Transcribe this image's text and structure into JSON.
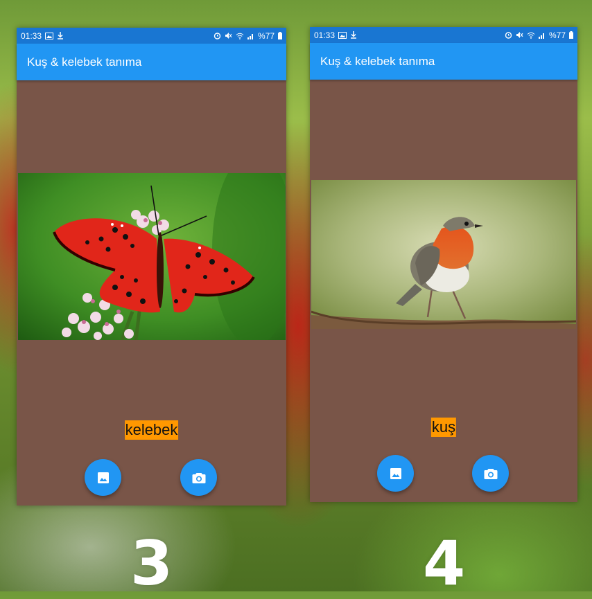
{
  "screens": [
    {
      "status": {
        "time": "01:33",
        "battery": "%77",
        "left_icons": [
          "image-icon",
          "download-icon"
        ],
        "right_icons": [
          "alarm-icon",
          "mute-icon",
          "wifi-icon",
          "signal-icon",
          "battery-icon"
        ]
      },
      "app_title": "Kuş & kelebek tanıma",
      "photo_subject": "red butterfly on pink flowers",
      "result_label": "kelebek",
      "buttons": {
        "gallery_icon": "image-icon",
        "camera_icon": "camera-icon"
      },
      "step_number": "3"
    },
    {
      "status": {
        "time": "01:33",
        "battery": "%77",
        "left_icons": [
          "image-icon",
          "download-icon"
        ],
        "right_icons": [
          "alarm-icon",
          "mute-icon",
          "wifi-icon",
          "signal-icon",
          "battery-icon"
        ]
      },
      "app_title": "Kuş & kelebek tanıma",
      "photo_subject": "robin bird on a log",
      "result_label": "kuş",
      "buttons": {
        "gallery_icon": "image-icon",
        "camera_icon": "camera-icon"
      },
      "step_number": "4"
    }
  ],
  "colors": {
    "status_bar": "#1976d2",
    "app_bar": "#2196f3",
    "screen_bg": "#795548",
    "label_bg": "#ff9800",
    "fab": "#2196f3"
  }
}
